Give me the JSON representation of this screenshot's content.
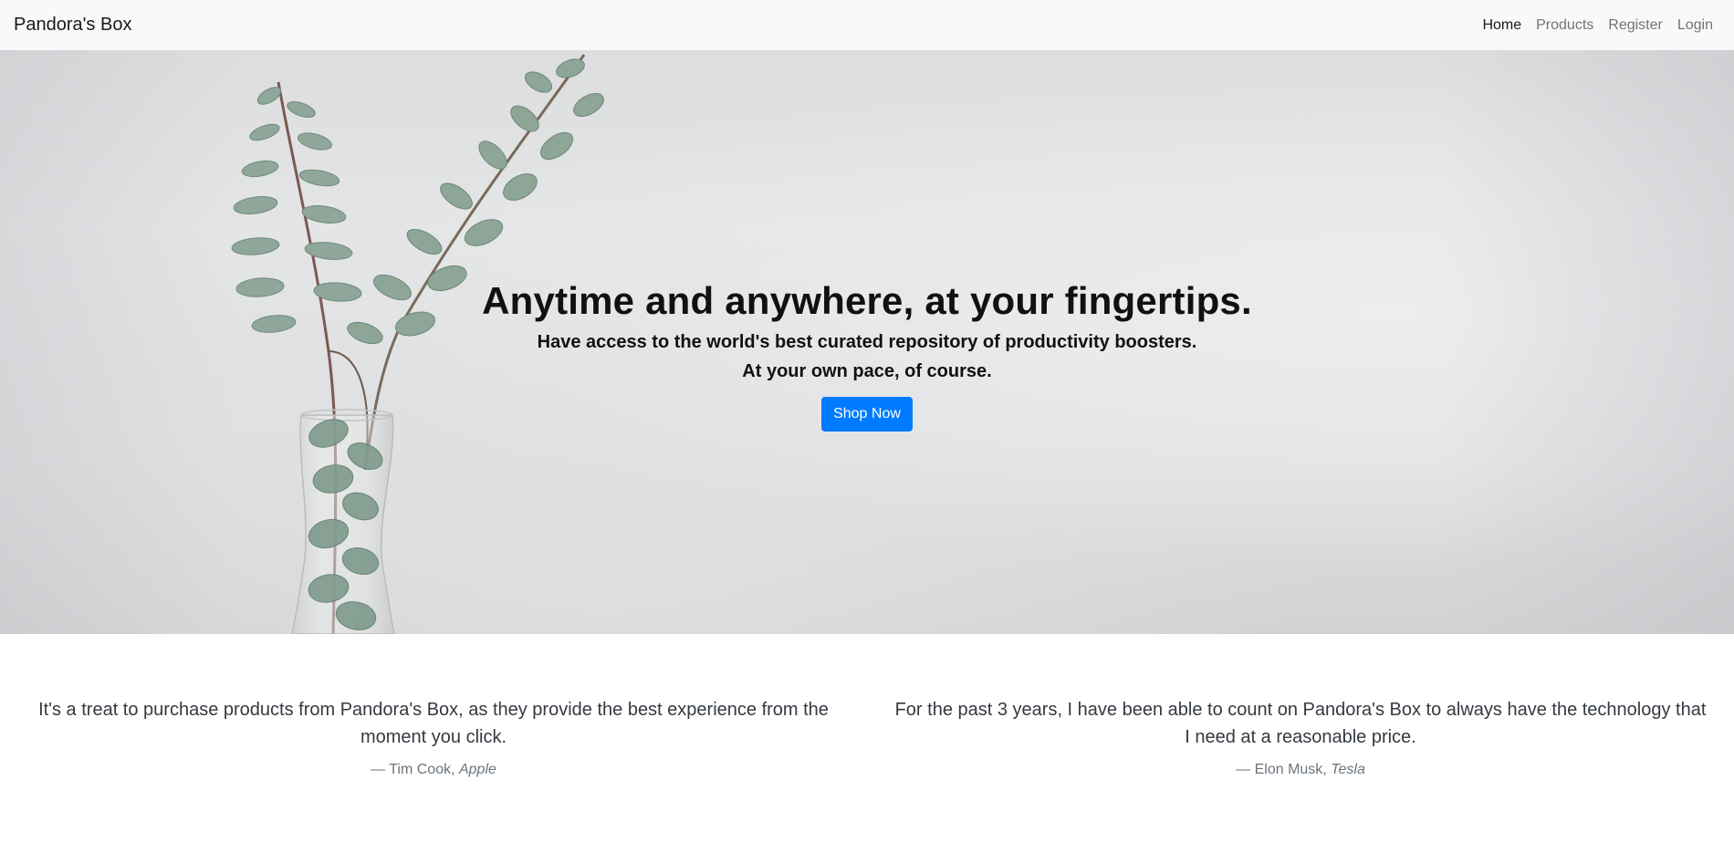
{
  "navbar": {
    "brand": "Pandora's Box",
    "links": [
      {
        "label": "Home"
      },
      {
        "label": "Products"
      },
      {
        "label": "Register"
      },
      {
        "label": "Login"
      }
    ]
  },
  "hero": {
    "title": "Anytime and anywhere, at your fingertips.",
    "subtitle_line1": "Have access to the world's best curated repository of productivity boosters.",
    "subtitle_line2": "At your own pace, of course.",
    "cta_label": "Shop Now",
    "cta_color": "#007bff"
  },
  "testimonials": [
    {
      "quote": "It's a treat to purchase products from Pandora's Box, as they provide the best experience from the moment you click.",
      "dash": "— ",
      "author": "Tim Cook, ",
      "company": "Apple"
    },
    {
      "quote": "For the past 3 years, I have been able to count on Pandora's Box to always have the technology that I need at a reasonable price.",
      "dash": "— ",
      "author": "Elon Musk, ",
      "company": "Tesla"
    }
  ]
}
